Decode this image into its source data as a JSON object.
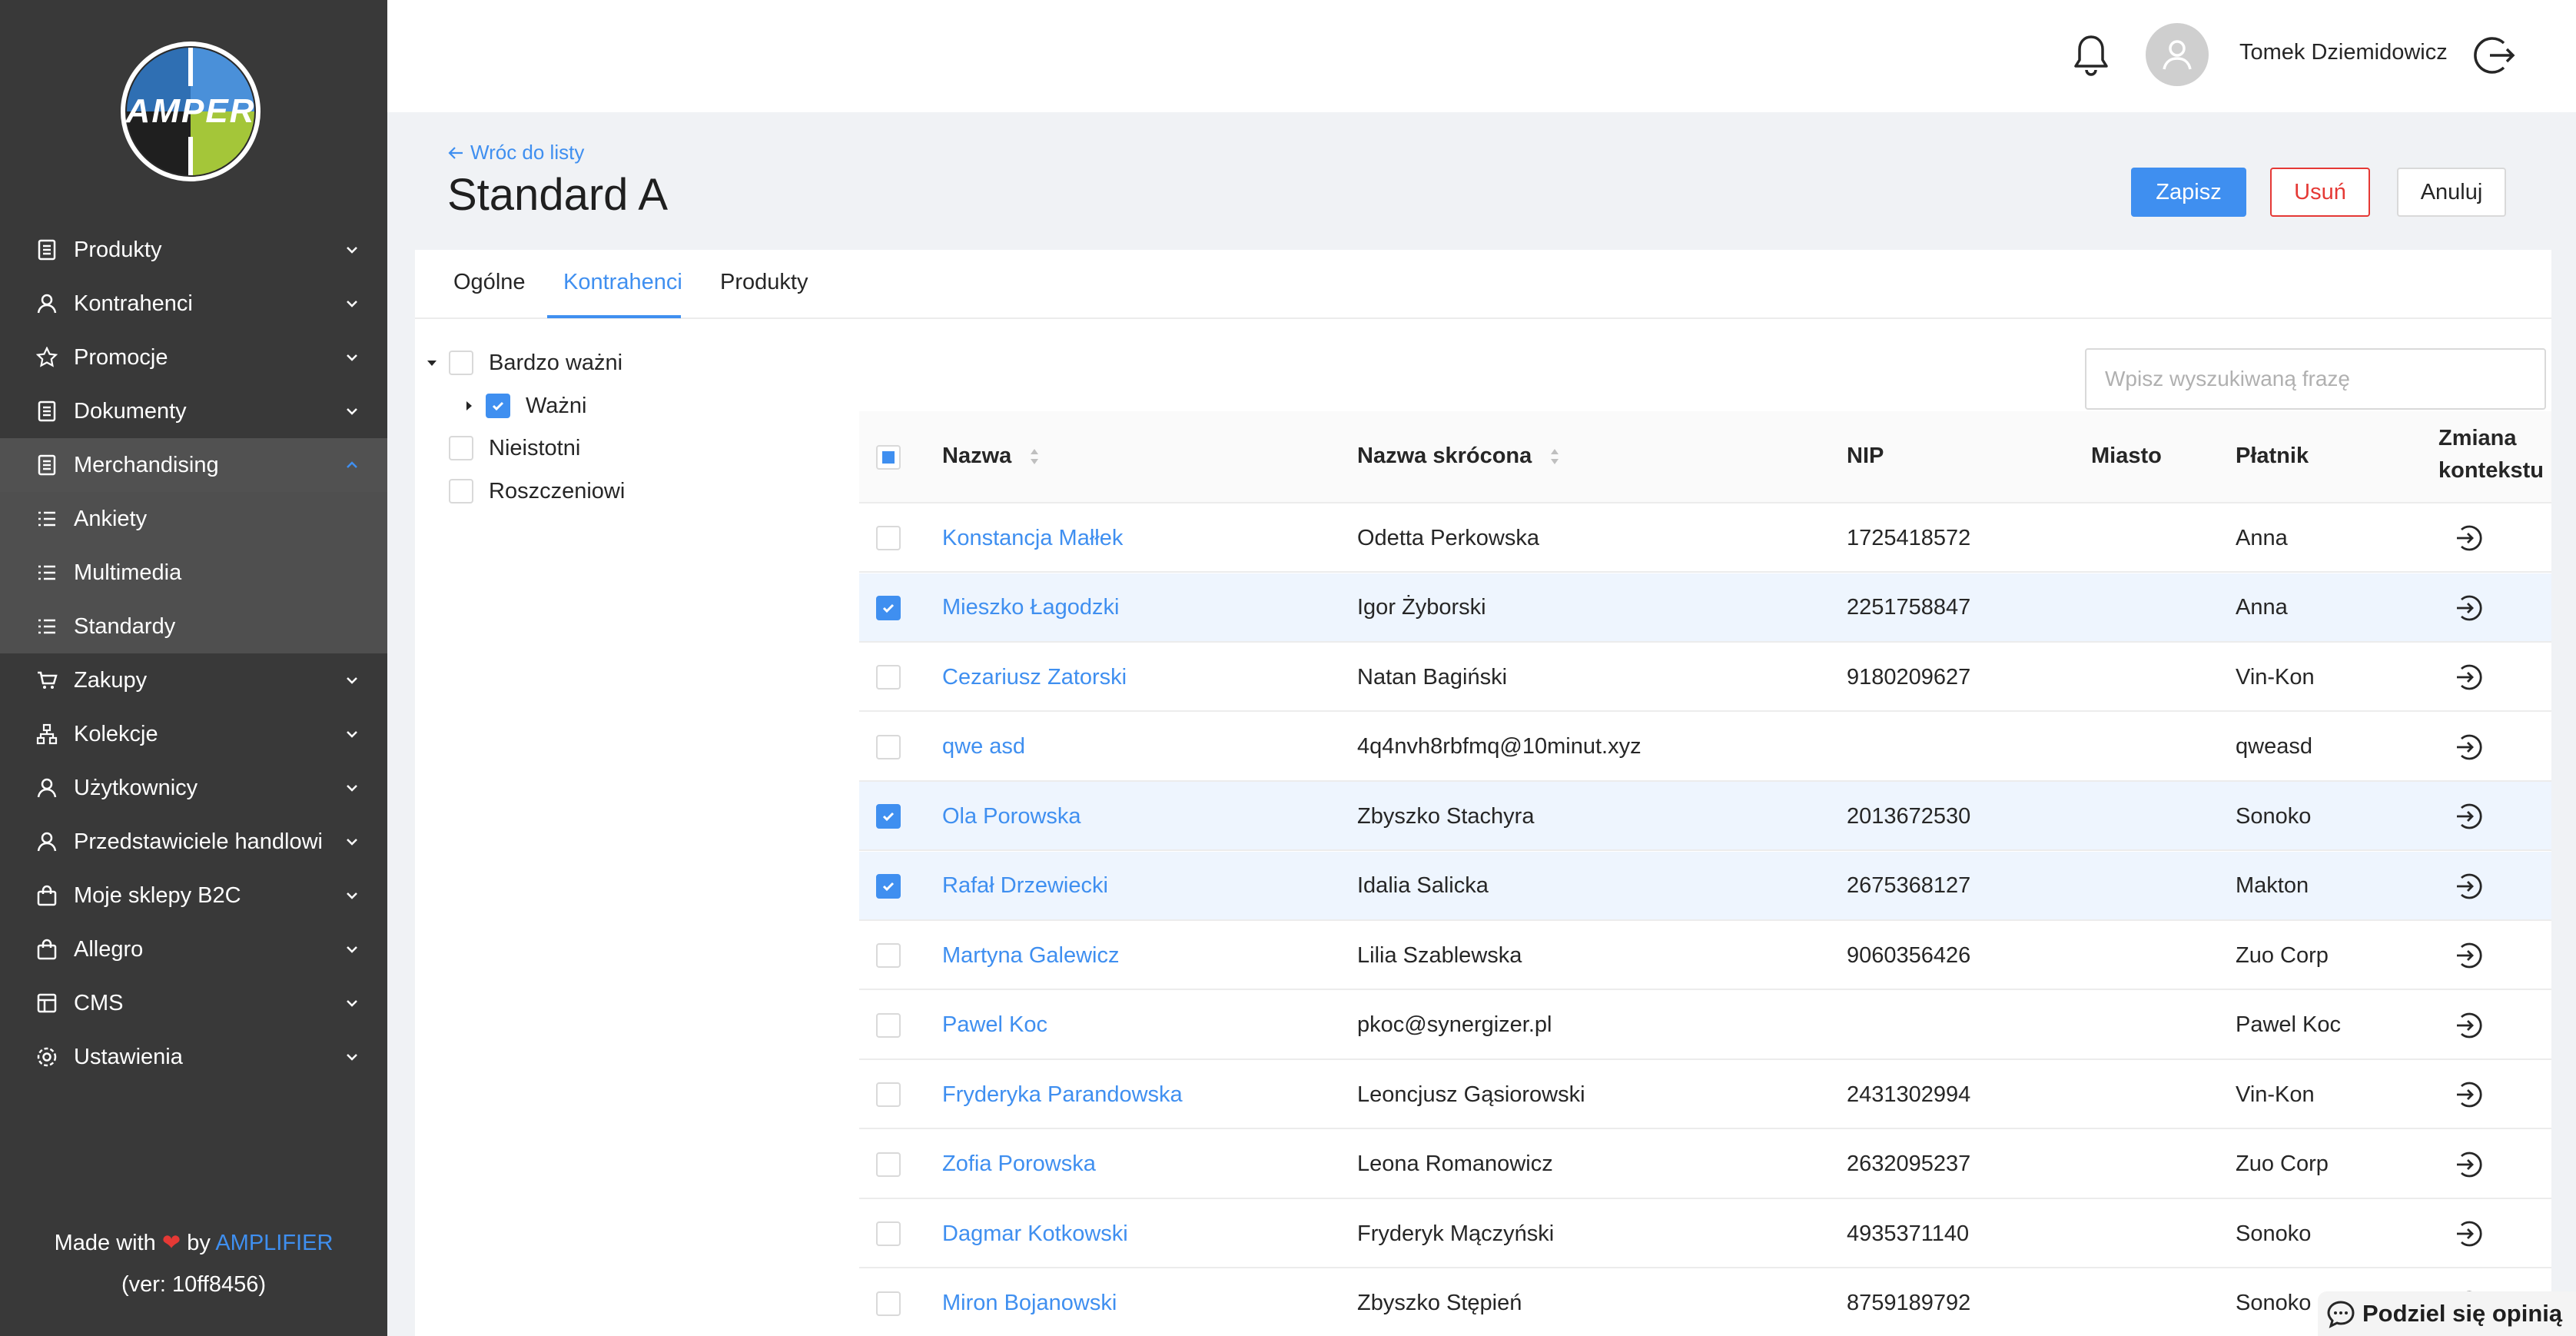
{
  "sidebar": {
    "logo_text": "AMPER",
    "items": [
      {
        "label": "Produkty",
        "icon": "document-icon"
      },
      {
        "label": "Kontrahenci",
        "icon": "user-icon"
      },
      {
        "label": "Promocje",
        "icon": "star-icon"
      },
      {
        "label": "Dokumenty",
        "icon": "document-icon"
      },
      {
        "label": "Merchandising",
        "icon": "document-icon",
        "expanded": true
      },
      {
        "label": "Zakupy",
        "icon": "cart-icon"
      },
      {
        "label": "Kolekcje",
        "icon": "hierarchy-icon"
      },
      {
        "label": "Użytkownicy",
        "icon": "user-icon"
      },
      {
        "label": "Przedstawiciele handlowi",
        "icon": "user-icon"
      },
      {
        "label": "Moje sklepy B2C",
        "icon": "bag-icon"
      },
      {
        "label": "Allegro",
        "icon": "bag-icon"
      },
      {
        "label": "CMS",
        "icon": "layout-icon"
      },
      {
        "label": "Ustawienia",
        "icon": "gear-icon"
      }
    ],
    "subitems": [
      {
        "label": "Ankiety",
        "icon": "list-icon"
      },
      {
        "label": "Multimedia",
        "icon": "list-icon"
      },
      {
        "label": "Standardy",
        "icon": "list-icon",
        "active": true
      }
    ],
    "footer": {
      "made_with": "Made with",
      "by": "by",
      "brand": "AMPLIFIER",
      "version": "(ver: 10ff8456)"
    }
  },
  "header": {
    "user_name": "Tomek Dziemidowicz"
  },
  "page": {
    "back_label": "Wróc do listy",
    "title": "Standard A",
    "save_label": "Zapisz",
    "delete_label": "Usuń",
    "cancel_label": "Anuluj"
  },
  "tabs": [
    "Ogólne",
    "Kontrahenci",
    "Produkty"
  ],
  "active_tab": "Kontrahenci",
  "tree": [
    {
      "label": "Bardzo ważni",
      "checked": false,
      "level": 0,
      "expanded": true
    },
    {
      "label": "Ważni",
      "checked": true,
      "level": 1,
      "expanded": false
    },
    {
      "label": "Nieistotni",
      "checked": false,
      "level": 0
    },
    {
      "label": "Roszczeniowi",
      "checked": false,
      "level": 0
    }
  ],
  "search": {
    "placeholder": "Wpisz wyszukiwaną frazę"
  },
  "table": {
    "columns": {
      "name": "Nazwa",
      "short_name": "Nazwa skrócona",
      "nip": "NIP",
      "city": "Miasto",
      "payer": "Płatnik",
      "context_1": "Zmiana",
      "context_2": "kontekstu"
    },
    "rows": [
      {
        "name": "Konstancja Małłek",
        "short_name": "Odetta Perkowska",
        "nip": "1725418572",
        "city": "",
        "payer": "Anna",
        "checked": false
      },
      {
        "name": "Mieszko Łagodzki",
        "short_name": "Igor Żyborski",
        "nip": "2251758847",
        "city": "",
        "payer": "Anna",
        "checked": true
      },
      {
        "name": "Cezariusz Zatorski",
        "short_name": "Natan Bagiński",
        "nip": "9180209627",
        "city": "",
        "payer": "Vin-Kon",
        "checked": false
      },
      {
        "name": "qwe asd",
        "short_name": "4q4nvh8rbfmq@10minut.xyz",
        "nip": "",
        "city": "",
        "payer": "qweasd",
        "checked": false
      },
      {
        "name": "Ola Porowska",
        "short_name": "Zbyszko Stachyra",
        "nip": "2013672530",
        "city": "",
        "payer": "Sonoko",
        "checked": true
      },
      {
        "name": "Rafał Drzewiecki",
        "short_name": "Idalia Salicka",
        "nip": "2675368127",
        "city": "",
        "payer": "Makton",
        "checked": true
      },
      {
        "name": "Martyna Galewicz",
        "short_name": "Lilia Szablewska",
        "nip": "9060356426",
        "city": "",
        "payer": "Zuo Corp",
        "checked": false
      },
      {
        "name": "Pawel Koc",
        "short_name": "pkoc@synergizer.pl",
        "nip": "",
        "city": "",
        "payer": "Pawel Koc",
        "checked": false
      },
      {
        "name": "Fryderyka Parandowska",
        "short_name": "Leoncjusz Gąsiorowski",
        "nip": "2431302994",
        "city": "",
        "payer": "Vin-Kon",
        "checked": false
      },
      {
        "name": "Zofia Porowska",
        "short_name": "Leona Romanowicz",
        "nip": "2632095237",
        "city": "",
        "payer": "Zuo Corp",
        "checked": false
      },
      {
        "name": "Dagmar Kotkowski",
        "short_name": "Fryderyk Mączyński",
        "nip": "4935371140",
        "city": "",
        "payer": "Sonoko",
        "checked": false
      },
      {
        "name": "Miron Bojanowski",
        "short_name": "Zbyszko Stępień",
        "nip": "8759189792",
        "city": "",
        "payer": "Sonoko",
        "checked": false
      }
    ]
  },
  "feedback": {
    "label": "Podziel się opinią"
  },
  "colors": {
    "accent": "#3f8ff0",
    "danger": "#e53935",
    "sidebar_bg": "#393939",
    "selected_row": "#eef5fe"
  }
}
